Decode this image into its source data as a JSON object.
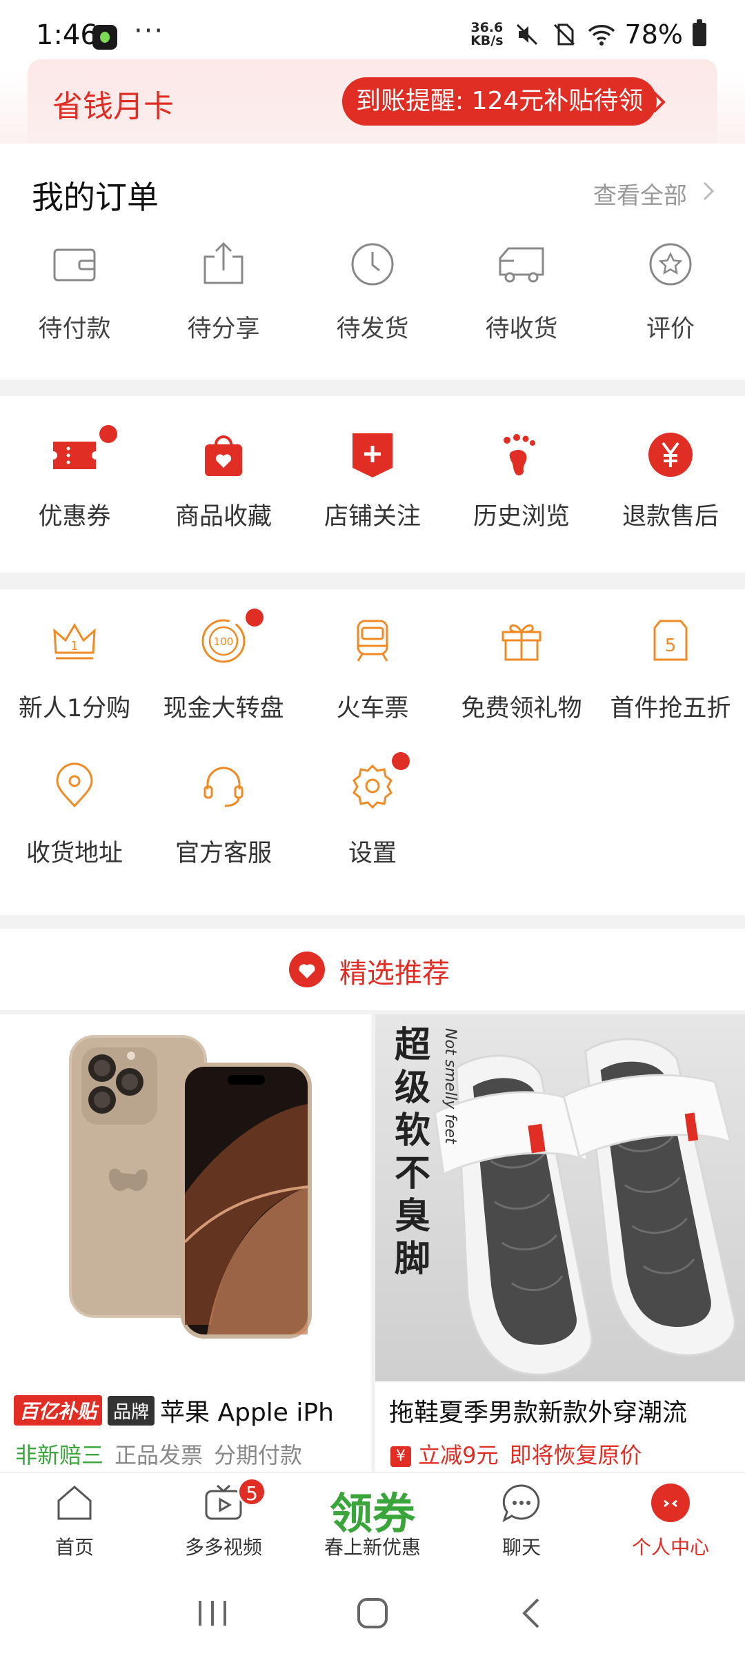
{
  "status_bar": {
    "time": "1:46",
    "more": "···",
    "net_speed_value": "36.6",
    "net_speed_unit": "KB/s",
    "battery": "78%"
  },
  "banner": {
    "title": "省钱月卡",
    "notice": "到账提醒: 124元补贴待领"
  },
  "orders": {
    "title": "我的订单",
    "view_all": "查看全部",
    "items": [
      {
        "label": "待付款",
        "icon": "wallet-icon"
      },
      {
        "label": "待分享",
        "icon": "share-icon"
      },
      {
        "label": "待发货",
        "icon": "clock-icon"
      },
      {
        "label": "待收货",
        "icon": "truck-icon"
      },
      {
        "label": "评价",
        "icon": "star-icon"
      }
    ]
  },
  "services": {
    "items": [
      {
        "label": "优惠券",
        "icon": "coupon-icon",
        "dot": true
      },
      {
        "label": "商品收藏",
        "icon": "bag-heart-icon",
        "dot": false
      },
      {
        "label": "店铺关注",
        "icon": "store-plus-icon",
        "dot": false
      },
      {
        "label": "历史浏览",
        "icon": "footprint-icon",
        "dot": false
      },
      {
        "label": "退款售后",
        "icon": "yen-icon",
        "dot": false
      }
    ]
  },
  "tools": {
    "items": [
      {
        "label": "新人1分购",
        "icon": "crown-icon",
        "dot": false
      },
      {
        "label": "现金大转盘",
        "icon": "wheel-100-icon",
        "dot": true
      },
      {
        "label": "火车票",
        "icon": "train-icon",
        "dot": false
      },
      {
        "label": "免费领礼物",
        "icon": "gift-icon",
        "dot": false
      },
      {
        "label": "首件抢五折",
        "icon": "tag-5-icon",
        "dot": false
      },
      {
        "label": "收货地址",
        "icon": "location-icon",
        "dot": false
      },
      {
        "label": "官方客服",
        "icon": "headset-icon",
        "dot": false
      },
      {
        "label": "设置",
        "icon": "gear-icon",
        "dot": true
      }
    ]
  },
  "recommend": {
    "title": "精选推荐"
  },
  "products": [
    {
      "badge": "百亿补贴",
      "brand_tag": "品牌",
      "title": "苹果 Apple iPh",
      "tags": [
        "非新赔三",
        "正品发票",
        "分期付款"
      ]
    },
    {
      "title": "拖鞋夏季男款新款外穿潮流",
      "image_text": "超级软 不臭脚",
      "image_subtext": "Not smelly feet",
      "promo": "立减9元",
      "promo_note": "即将恢复原价"
    }
  ],
  "tab_bar": {
    "items": [
      {
        "label": "首页"
      },
      {
        "label": "多多视频",
        "badge": "5"
      },
      {
        "label": "春上新优惠",
        "big": "领券"
      },
      {
        "label": "聊天"
      },
      {
        "label": "个人中心"
      }
    ]
  },
  "colors": {
    "brand_red": "#e02e24",
    "accent_orange": "#f08a24",
    "promo_green": "#3aa53a"
  }
}
